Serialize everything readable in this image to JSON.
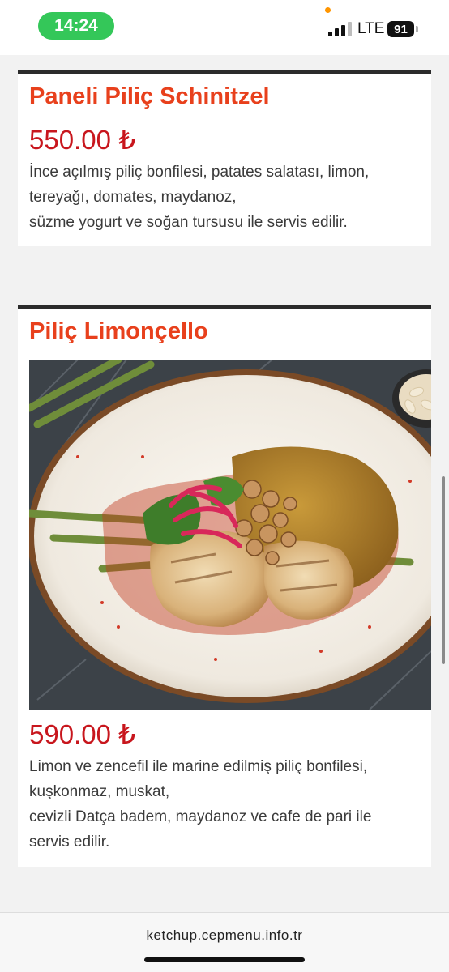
{
  "status_bar": {
    "time": "14:24",
    "network": "LTE",
    "battery": "91",
    "colors": {
      "time_pill": "#34c759",
      "indicator_dot": "#ff9500"
    }
  },
  "items": [
    {
      "title": "Paneli Piliç Schinitzel",
      "price": "550.00 ₺",
      "description_lines": [
        "İnce açılmış piliç bonfilesi, patates salatası, limon,",
        "tereyağı, domates, maydanoz,",
        "süzme yogurt ve soğan tursusu ile servis edilir."
      ]
    },
    {
      "title": "Piliç Limonçello",
      "image_icon": "food-photo",
      "price": "590.00 ₺",
      "description_lines": [
        "Limon ve zencefil ile marine edilmiş piliç bonfilesi,",
        "kuşkonmaz, muskat,",
        "cevizli Datça badem, maydanoz ve cafe de pari ile",
        "servis edilir."
      ]
    }
  ],
  "browser": {
    "url": "ketchup.cepmenu.info.tr"
  },
  "theme": {
    "title_color": "#e8401c",
    "price_color": "#c8161d",
    "card_border": "#2b2b2b"
  }
}
